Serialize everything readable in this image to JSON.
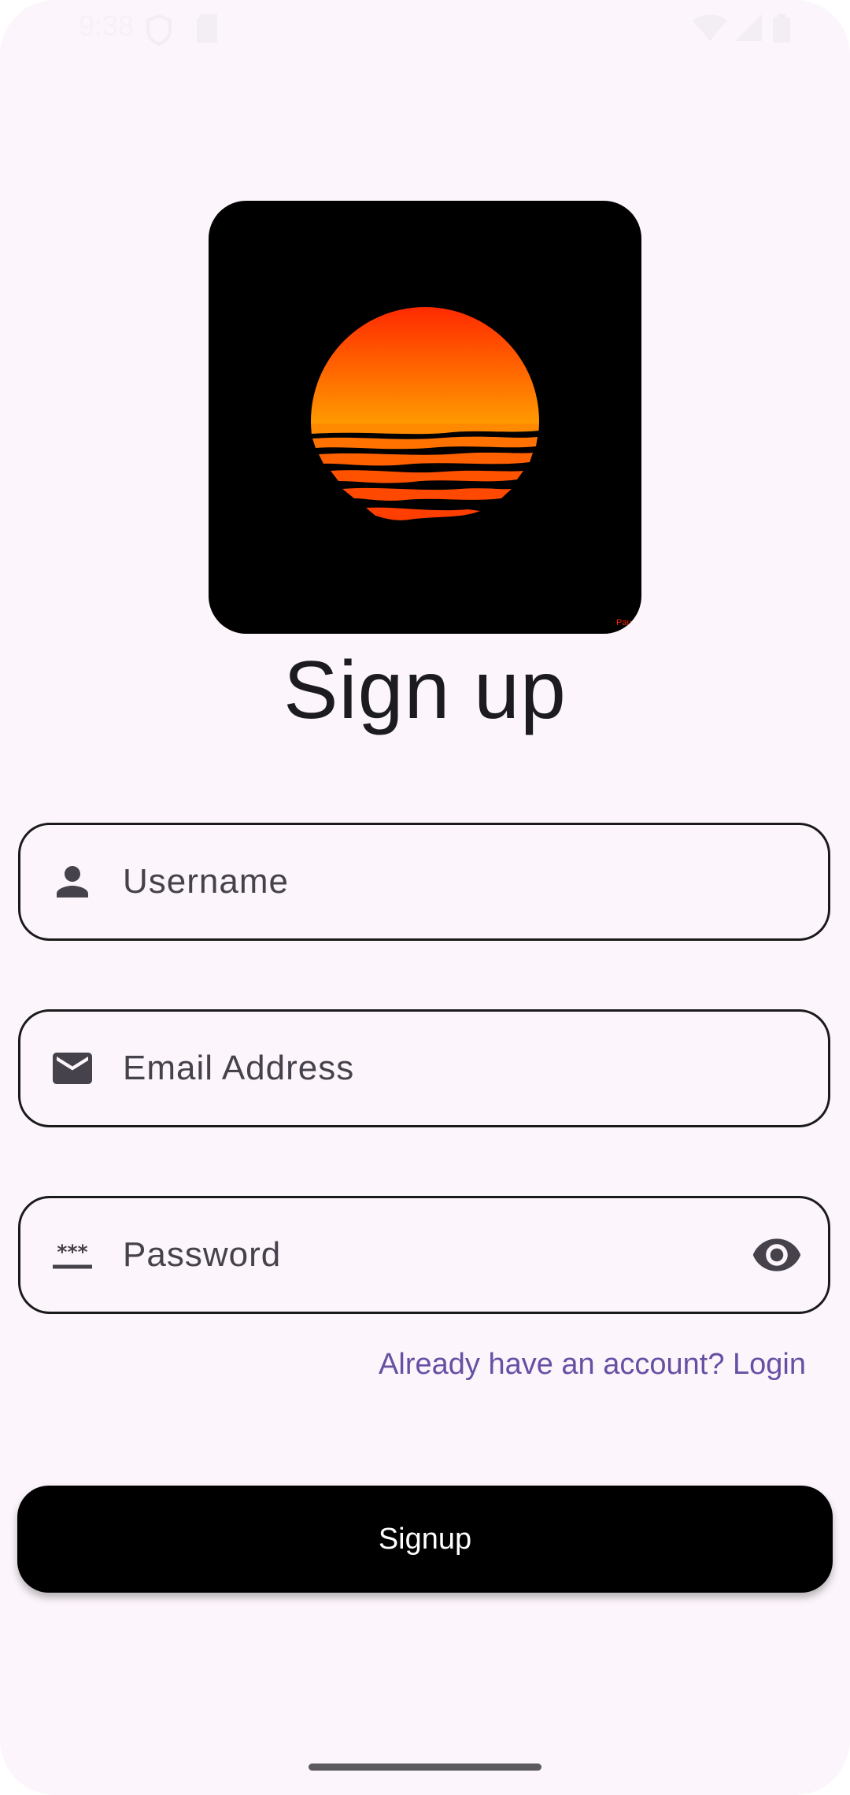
{
  "status_bar": {
    "time": "9:38",
    "icons": [
      "shield-icon",
      "sd-card-icon",
      "wifi-icon",
      "signal-icon",
      "battery-icon"
    ]
  },
  "logo": {
    "name": "sunset-logo",
    "watermark": "Pau"
  },
  "title": "Sign up",
  "form": {
    "username": {
      "placeholder": "Username",
      "icon": "person-icon"
    },
    "email": {
      "placeholder": "Email Address",
      "icon": "mail-icon"
    },
    "password": {
      "placeholder": "Password",
      "icon": "password-icon",
      "toggle_icon": "eye-icon"
    }
  },
  "login_link": "Already have an account? Login",
  "signup_button": "Signup",
  "colors": {
    "background": "#fcf5fb",
    "accent": "#6750a4",
    "button": "#000000",
    "sun_top": "#ff3300",
    "sun_bottom": "#ff9900"
  }
}
